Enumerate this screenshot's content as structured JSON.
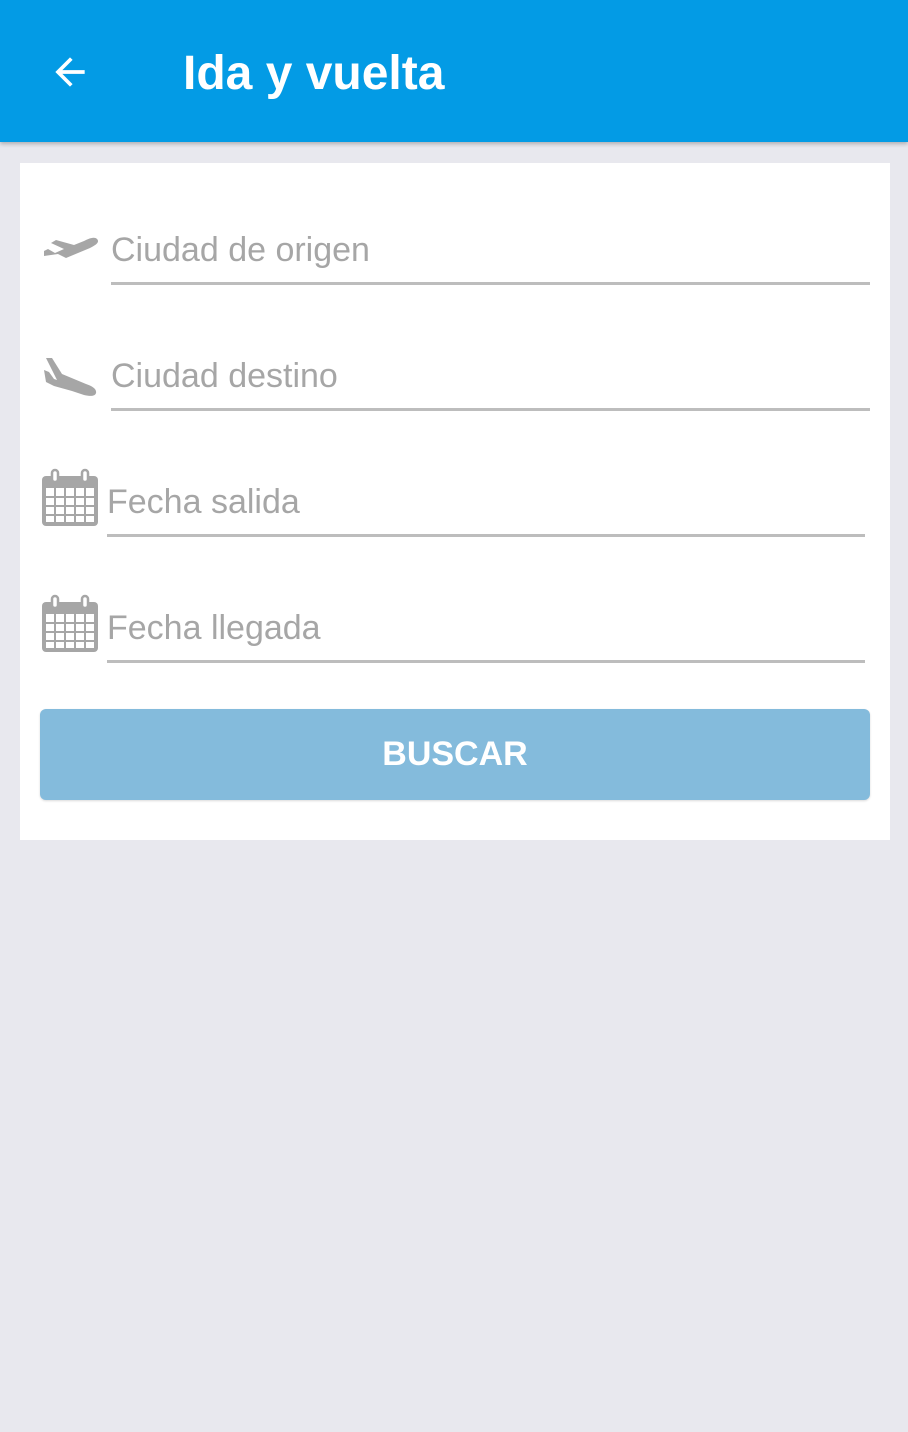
{
  "appbar": {
    "title": "Ida y vuelta",
    "back_icon": "arrow-back-icon",
    "color": "#039be5"
  },
  "form": {
    "origin": {
      "placeholder": "Ciudad de origen",
      "icon": "plane-takeoff-icon"
    },
    "destination": {
      "placeholder": "Ciudad destino",
      "icon": "plane-landing-icon"
    },
    "departure_date": {
      "placeholder": "Fecha salida",
      "icon": "calendar-icon"
    },
    "return_date": {
      "placeholder": "Fecha llegada",
      "icon": "calendar-icon"
    },
    "search_label": "BUSCAR",
    "search_color": "#84bbdc"
  }
}
